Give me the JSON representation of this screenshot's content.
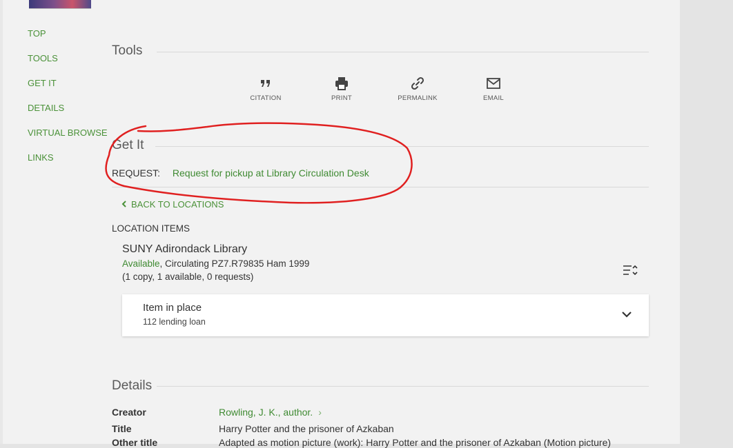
{
  "nav": {
    "items": [
      {
        "label": "TOP"
      },
      {
        "label": "TOOLS"
      },
      {
        "label": "GET IT"
      },
      {
        "label": "DETAILS"
      },
      {
        "label": "VIRTUAL BROWSE"
      },
      {
        "label": "LINKS"
      }
    ]
  },
  "tools": {
    "title": "Tools",
    "buttons": [
      {
        "label": "CITATION",
        "icon": "quote-icon"
      },
      {
        "label": "PRINT",
        "icon": "print-icon"
      },
      {
        "label": "PERMALINK",
        "icon": "link-icon"
      },
      {
        "label": "EMAIL",
        "icon": "email-icon"
      }
    ]
  },
  "getit": {
    "title": "Get It",
    "request_label": "REQUEST:",
    "request_link": "Request for pickup at Library Circulation Desk",
    "back_label": "BACK TO LOCATIONS",
    "location_items_label": "LOCATION ITEMS",
    "library_name": "SUNY Adirondack Library",
    "availability": "Available",
    "call_info": ", Circulating PZ7.R79835 Ham 1999",
    "copies": "(1 copy, 1 available, 0 requests)",
    "item": {
      "title": "Item in place",
      "policy": "112 lending loan"
    }
  },
  "details": {
    "title": "Details",
    "rows": [
      {
        "label": "Creator",
        "value": "Rowling, J. K., author."
      },
      {
        "label": "Title",
        "value": "Harry Potter and the prisoner of Azkaban"
      },
      {
        "label": "Other title",
        "value": "Adapted as motion picture (work): Harry Potter and the prisoner of Azkaban (Motion picture)"
      }
    ]
  },
  "colors": {
    "accent_green": "#4a9138",
    "annotation_red": "#e02020",
    "background": "#f2f2f2"
  }
}
